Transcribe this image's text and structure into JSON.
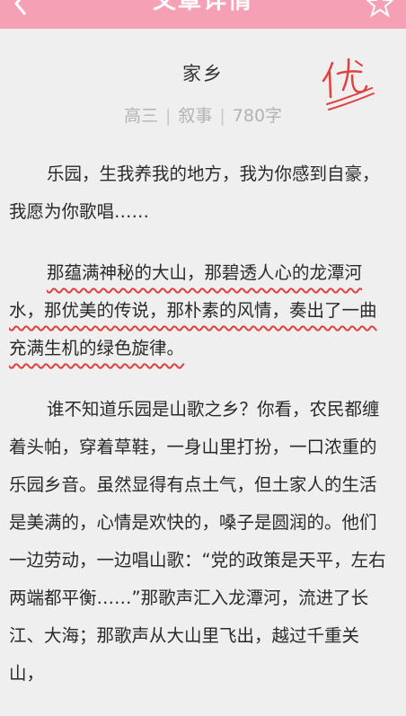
{
  "header": {
    "title": "文章详情",
    "back_icon": "chevron-left-icon",
    "favorite_icon": "star-outline-icon",
    "background": "#f5a0b4"
  },
  "article": {
    "title": "家乡",
    "meta": {
      "grade": "高三",
      "genre": "叙事",
      "word_count": "780字"
    },
    "grade_mark": "优",
    "grade_mark_color": "#e0403e",
    "paragraphs": [
      {
        "text": "乐园，生我养我的地方，我为你感到自豪，我愿为你歌唱……"
      },
      {
        "text": "那蕴满神秘的大山，那碧透人心的龙潭河水，那优美的传说，那朴素的风情，奏出了一曲充满生机的绿色旋律。",
        "highlighted": true
      },
      {
        "text": "谁不知道乐园是山歌之乡？你看，农民都缠着头帕，穿着草鞋，一身山里打扮，一口浓重的乐园乡音。虽然显得有点土气，但土家人的生活是美满的，心情是欢快的，嗓子是圆润的。他们一边劳动，一边唱山歌：“党的政策是天平，左右两端都平衡……”那歌声汇入龙潭河，流进了长江、大海；那歌声从大山里飞出，越过千重关山，"
      }
    ]
  }
}
